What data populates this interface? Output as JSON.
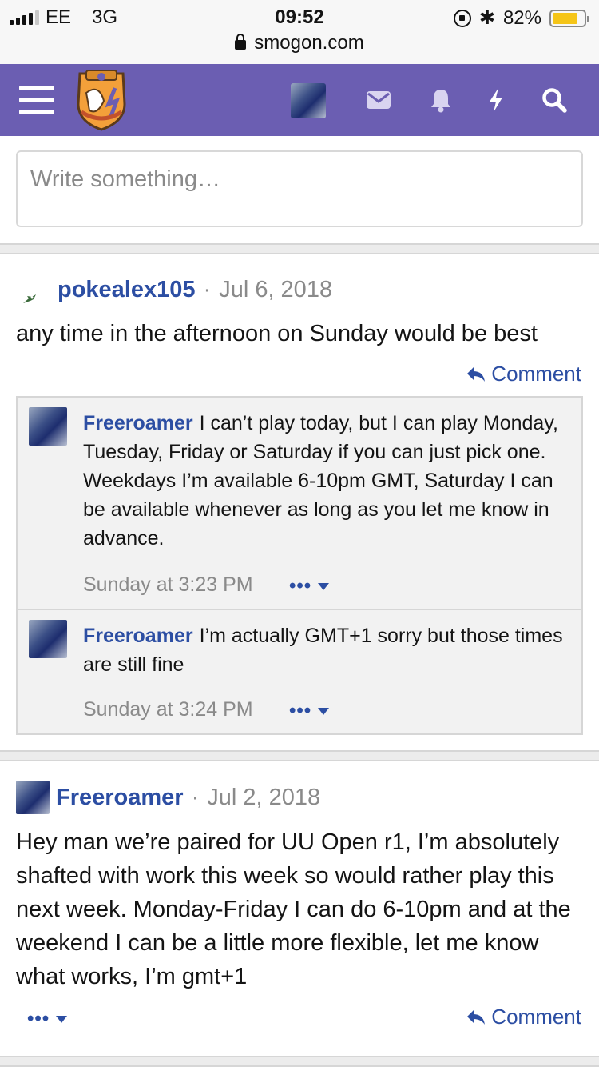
{
  "status": {
    "carrier": "EE",
    "network": "3G",
    "time": "09:52",
    "battery": "82%",
    "battery_level": 0.82
  },
  "browser": {
    "url": "smogon.com"
  },
  "nav": {
    "menu_icon": "hamburger-icon",
    "logo_icon": "smogon-logo",
    "icons": [
      "avatar",
      "envelope-icon",
      "bell-icon",
      "bolt-icon",
      "search-icon"
    ],
    "accent": "#6b5eb2"
  },
  "compose": {
    "placeholder": "Write something…"
  },
  "posts": [
    {
      "author": "pokealex105",
      "separator": "·",
      "date": "Jul 6, 2018",
      "body": "any time in the afternoon on Sunday would be best",
      "comment_label": "Comment",
      "comments": [
        {
          "author": "Freeroamer",
          "text": "I can’t play today, but I can play Monday, Tuesday, Friday or Saturday if you can just pick one. Weekdays I’m available 6-10pm GMT, Saturday I can be available whenever as long as you let me know in advance.",
          "time": "Sunday at 3:23 PM",
          "more": "•••"
        },
        {
          "author": "Freeroamer",
          "text": "I’m actually GMT+1 sorry but those times are still fine",
          "time": "Sunday at 3:24 PM",
          "more": "•••"
        }
      ]
    },
    {
      "author": "Freeroamer",
      "separator": "·",
      "date": "Jul 2, 2018",
      "body": "Hey man we’re paired for UU Open r1, I’m absolutely shafted with work this week so would rather play this next week. Monday-Friday I can do 6-10pm and at the weekend I can be a little more flexible, let me know what works, I’m gmt+1",
      "more": "•••",
      "comment_label": "Comment"
    }
  ],
  "colors": {
    "link": "#2c4ea3",
    "muted": "#8a8a8a"
  }
}
